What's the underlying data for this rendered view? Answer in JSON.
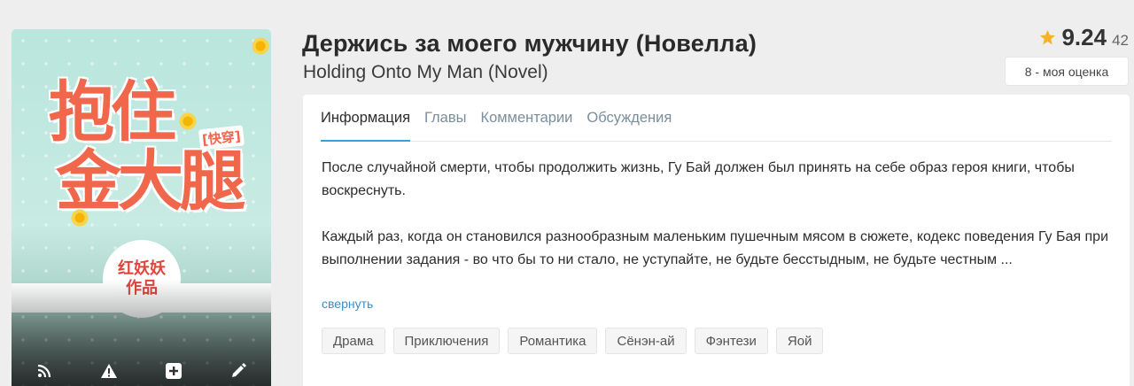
{
  "book": {
    "title": "Держись за моего мужчину (Новелла)",
    "subtitle": "Holding Onto My Man (Novel)"
  },
  "cover": {
    "title_line1": "抱住",
    "title_line2": "金大腿",
    "tag": "[快穿]",
    "author_line1": "红妖妖",
    "author_line2": "作品",
    "toolbar": [
      "rss-icon",
      "warning-icon",
      "plus-icon",
      "pencil-icon"
    ]
  },
  "rating": {
    "score": "9.24",
    "votes": "42",
    "my_rating": "8 - моя оценка",
    "star_color": "#f5b428"
  },
  "tabs": [
    {
      "label": "Информация",
      "active": true
    },
    {
      "label": "Главы"
    },
    {
      "label": "Комментарии"
    },
    {
      "label": "Обсуждения"
    }
  ],
  "description": {
    "p1": "После случайной смерти, чтобы продолжить жизнь, Гу Бай должен был принять на себе образ героя книги, чтобы воскреснуть.",
    "p2": "Каждый раз, когда он становился разнообразным маленьким пушечным мясом в сюжете, кодекс поведения Гу Бая при выполнении задания - во что бы то ни стало, не уступайте, не будьте бесстыдным, не будьте честным ...",
    "collapse": "свернуть"
  },
  "tags": [
    "Драма",
    "Приключения",
    "Романтика",
    "Сёнэн-ай",
    "Фэнтези",
    "Яой"
  ],
  "colors": {
    "accent": "#3aa0d8",
    "link": "#3a8fc7",
    "cover_title": "#f0674c"
  }
}
